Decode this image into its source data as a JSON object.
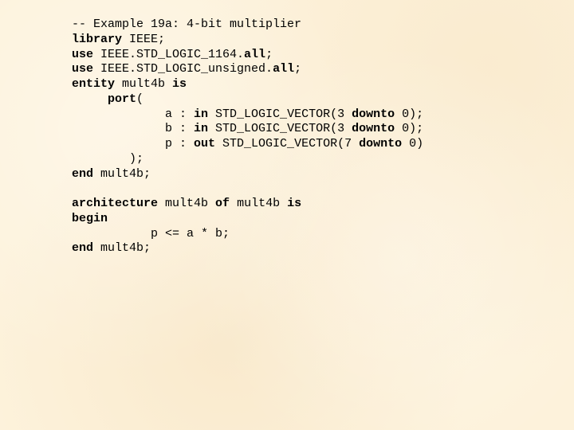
{
  "code": {
    "l1a": "-- Example 19a: 4-bit multiplier",
    "l2k": "library",
    "l2a": " IEEE;",
    "l3k1": "use",
    "l3a": " IEEE.STD_LOGIC_1164.",
    "l3k2": "all",
    "l3b": ";",
    "l4k1": "use",
    "l4a": " IEEE.STD_LOGIC_unsigned.",
    "l4k2": "all",
    "l4b": ";",
    "l5k1": "entity",
    "l5a": " mult4b ",
    "l5k2": "is",
    "l6k": "port",
    "l6a": "(",
    "l7a": "             a : ",
    "l7k1": "in",
    "l7b": " STD_LOGIC_VECTOR(3 ",
    "l7k2": "downto",
    "l7c": " 0);",
    "l8a": "             b : ",
    "l8k1": "in",
    "l8b": " STD_LOGIC_VECTOR(3 ",
    "l8k2": "downto",
    "l8c": " 0);",
    "l9a": "             p : ",
    "l9k1": "out",
    "l9b": " STD_LOGIC_VECTOR(7 ",
    "l9k2": "downto",
    "l9c": " 0)",
    "l10a": "        );",
    "l11k": "end",
    "l11a": " mult4b;",
    "blank": "",
    "l13k1": "architecture",
    "l13a": " mult4b ",
    "l13k2": "of",
    "l13b": " mult4b ",
    "l13k3": "is",
    "l14k": "begin",
    "l15a": "           p <= a * b;",
    "l16k": "end",
    "l16a": " mult4b;",
    "indent_port": "     ",
    "eol": "\n"
  }
}
